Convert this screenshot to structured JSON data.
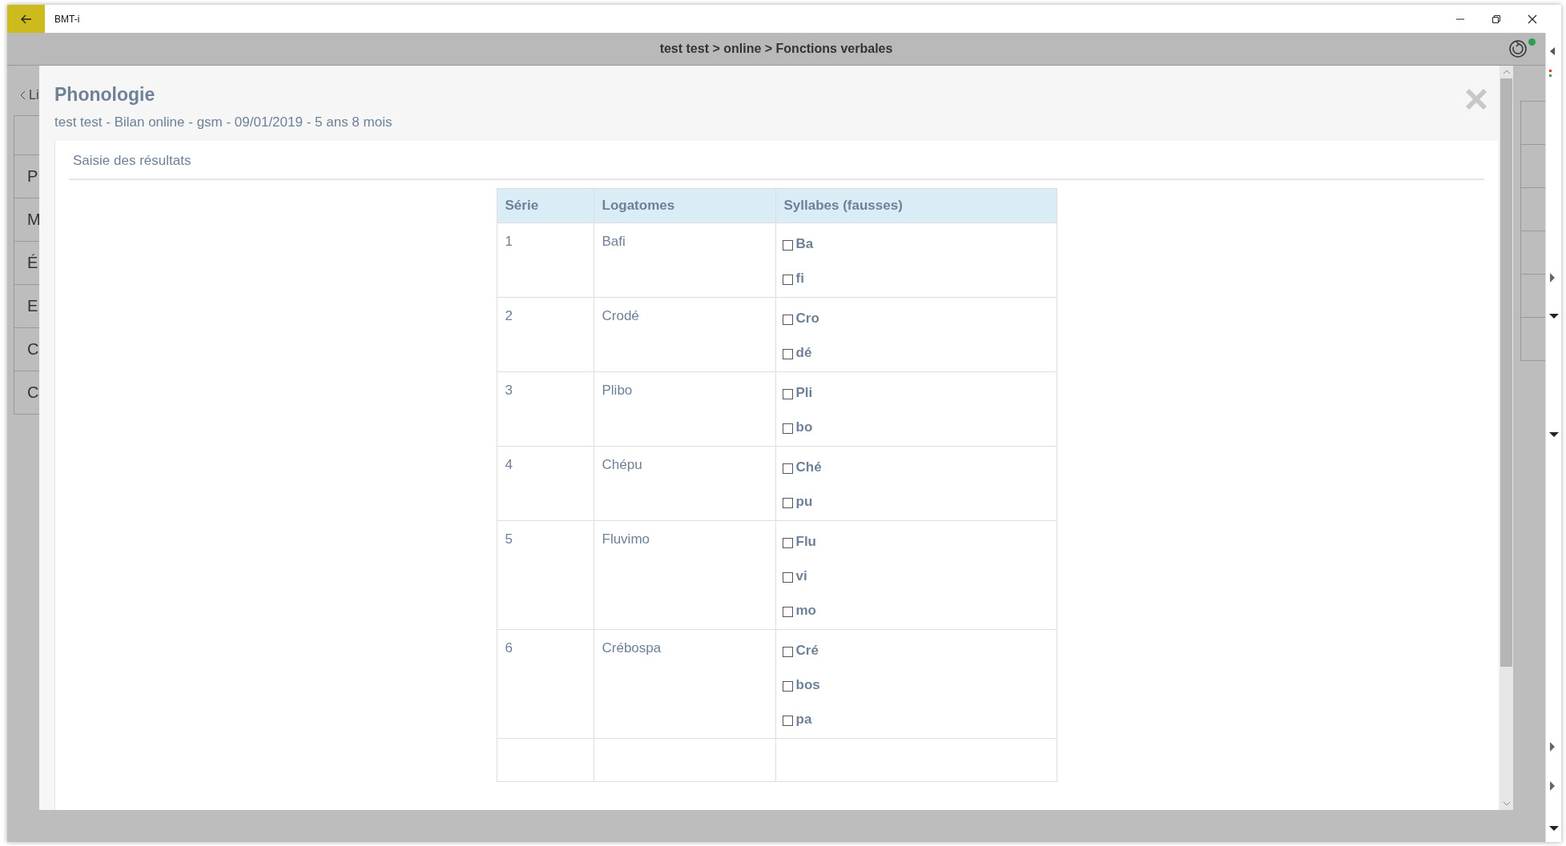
{
  "window": {
    "title": "BMT-i"
  },
  "breadcrumb": "test test > online > Fonctions verbales",
  "status": {
    "online": true
  },
  "background_list": {
    "back_link": "Li",
    "items": [
      "P",
      "M",
      "É",
      "E",
      "C",
      "C"
    ]
  },
  "modal": {
    "title": "Phonologie",
    "subtitle": "test test - Bilan online - gsm - 09/01/2019 - 5 ans 8 mois",
    "section": "Saisie des résultats",
    "table": {
      "columns": [
        "Série",
        "Logatomes",
        "Syllabes (fausses)"
      ],
      "rows": [
        {
          "serie": "1",
          "word": "Bafi",
          "syllables": [
            {
              "label": "Ba",
              "checked": false
            },
            {
              "label": "fi",
              "checked": false
            }
          ]
        },
        {
          "serie": "2",
          "word": "Crodé",
          "syllables": [
            {
              "label": "Cro",
              "checked": false
            },
            {
              "label": "dé",
              "checked": false
            }
          ]
        },
        {
          "serie": "3",
          "word": "Plibo",
          "syllables": [
            {
              "label": "Pli",
              "checked": false
            },
            {
              "label": "bo",
              "checked": false
            }
          ]
        },
        {
          "serie": "4",
          "word": "Chépu",
          "syllables": [
            {
              "label": "Ché",
              "checked": false
            },
            {
              "label": "pu",
              "checked": false
            }
          ]
        },
        {
          "serie": "5",
          "word": "Fluvimo",
          "syllables": [
            {
              "label": "Flu",
              "checked": false
            },
            {
              "label": "vi",
              "checked": false
            },
            {
              "label": "mo",
              "checked": false
            }
          ]
        },
        {
          "serie": "6",
          "word": "Crébospa",
          "syllables": [
            {
              "label": "Cré",
              "checked": false
            },
            {
              "label": "bos",
              "checked": false
            },
            {
              "label": "pa",
              "checked": false
            }
          ]
        }
      ]
    }
  }
}
